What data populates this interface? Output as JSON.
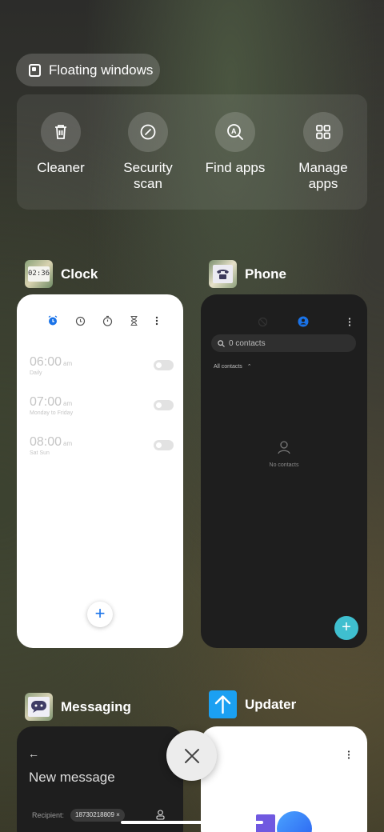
{
  "floating_windows": {
    "label": "Floating windows",
    "icon": "floating-window-icon"
  },
  "tools": [
    {
      "label": "Cleaner",
      "icon": "trash-icon"
    },
    {
      "label": "Security scan",
      "icon": "security-scan-icon"
    },
    {
      "label": "Find apps",
      "icon": "find-apps-icon"
    },
    {
      "label": "Manage apps",
      "icon": "grid-icon"
    }
  ],
  "recent_apps": {
    "clock": {
      "name": "Clock",
      "icon_text": "02:36",
      "alarms": [
        {
          "time": "06:00",
          "ampm": "am",
          "repeat": "Daily"
        },
        {
          "time": "07:00",
          "ampm": "am",
          "repeat": "Monday to Friday"
        },
        {
          "time": "08:00",
          "ampm": "am",
          "repeat": "Sat Sun"
        }
      ],
      "add_label": "+"
    },
    "phone": {
      "name": "Phone",
      "search_placeholder": "0 contacts",
      "filter_label": "All contacts",
      "empty_label": "No contacts",
      "add_label": "+"
    },
    "messaging": {
      "name": "Messaging",
      "title": "New message",
      "recipient_label": "Recipient:",
      "recipient_chip": "18730218809 ×",
      "back_glyph": "←"
    },
    "updater": {
      "name": "Updater"
    }
  },
  "colors": {
    "clock_accent": "#1a73e8",
    "phone_fab": "#3fbfcf",
    "updater_icon": "#1ba0f2"
  }
}
